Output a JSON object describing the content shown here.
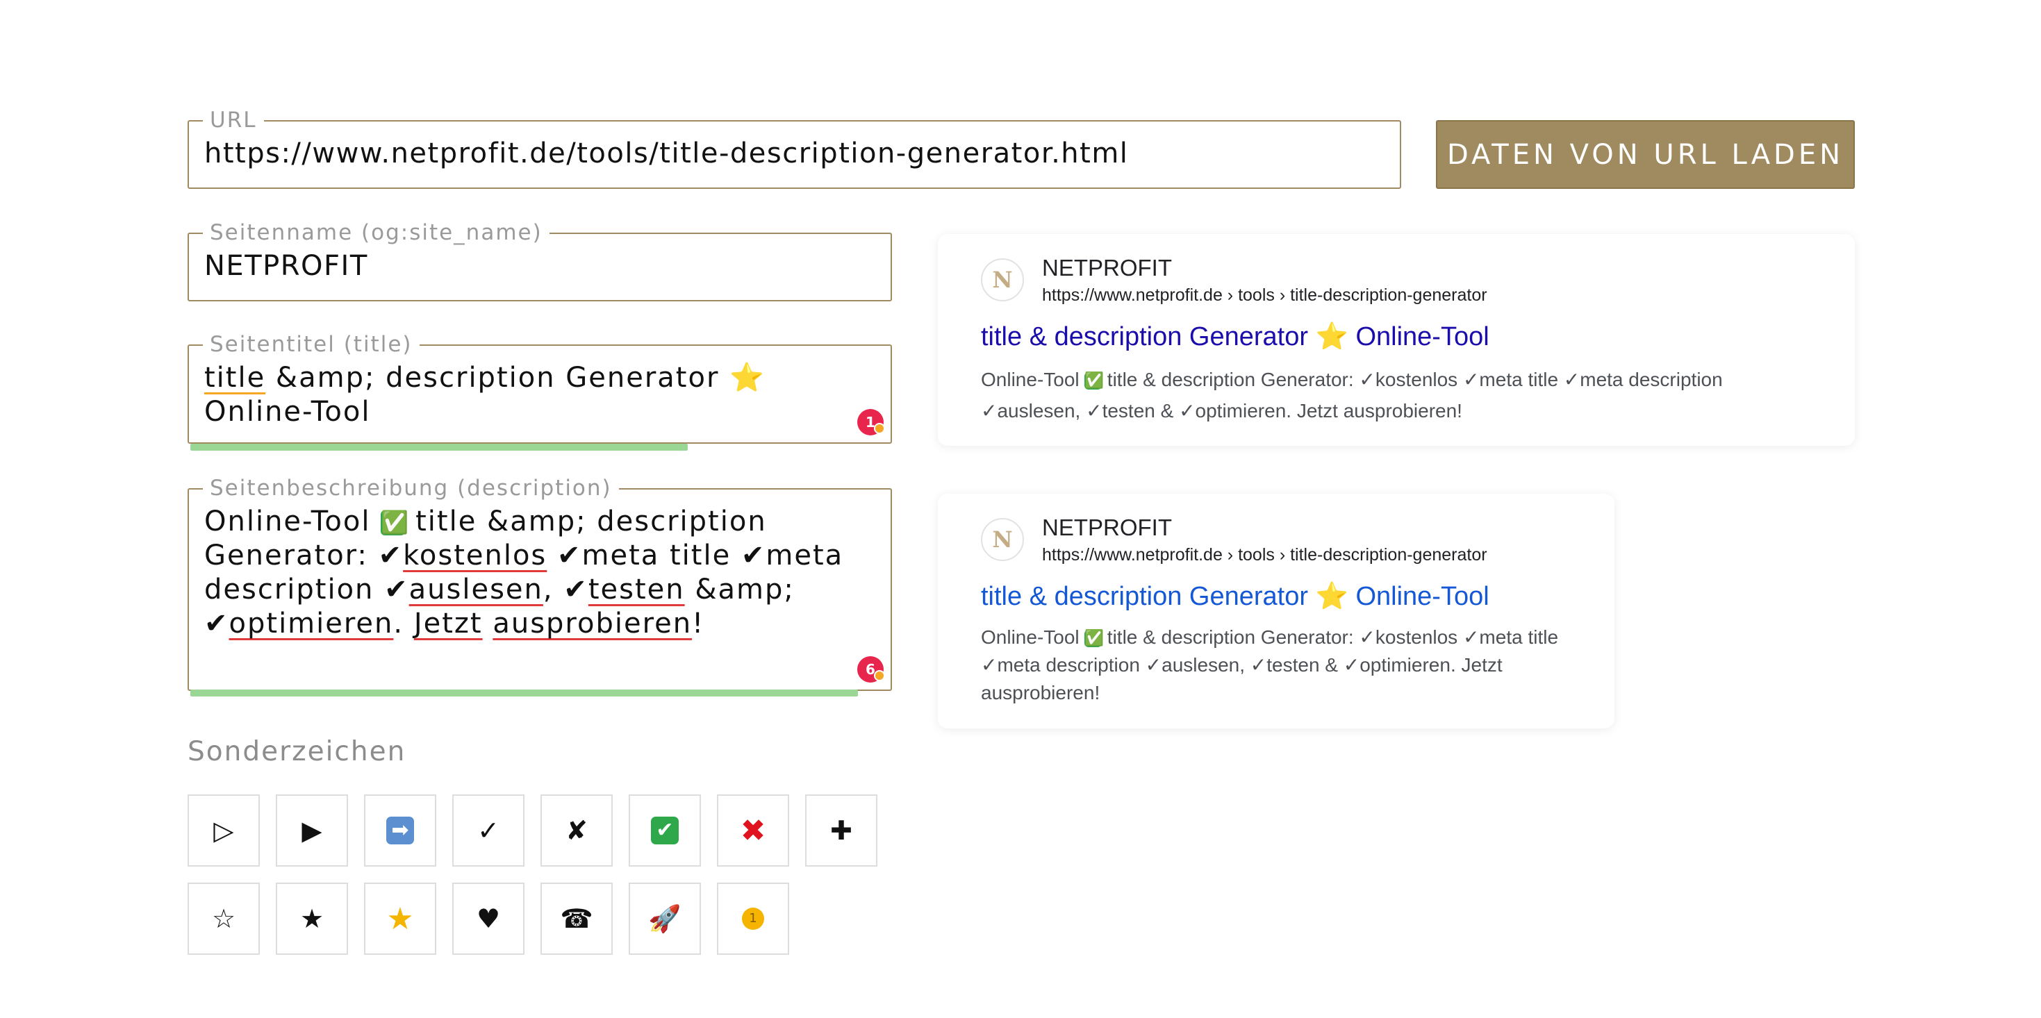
{
  "url_field": {
    "label": "URL",
    "value": "https://www.netprofit.de/tools/title-description-generator.html"
  },
  "load_button": {
    "label": "DATEN VON URL LADEN"
  },
  "site_name_field": {
    "label": "Seitenname (og:site_name)",
    "value": "NETPROFIT"
  },
  "title_field": {
    "label": "Seitentitel (title)",
    "value_parts": {
      "w1": "title",
      "t1": " &amp; description Generator ",
      "star": "⭐",
      "t2": " Online-Tool"
    },
    "counter": "1",
    "length_fraction": 0.712
  },
  "description_field": {
    "label": "Seitenbeschreibung (description)",
    "value_parts": {
      "t1": "Online-Tool ",
      "check": "✅",
      "t2": " title &amp; description Generator: ✔",
      "w1": "kostenlos",
      "t3": " ✔meta title ✔meta description ✔",
      "w2": "auslesen",
      "t4": ", ✔",
      "w3": "testen",
      "t5": " &amp; ✔",
      "w4": "optimieren",
      "t6": ". ",
      "w5": "Jetzt",
      "t7": " ",
      "w6": "ausprobieren",
      "t8": "!"
    },
    "counter": "6",
    "length_fraction": 0.955
  },
  "preview_desktop": {
    "favicon": "N",
    "site_name": "NETPROFIT",
    "url": "https://www.netprofit.de › tools › title-description-generator",
    "title": {
      "t1": "title & description Generator ",
      "star": "⭐",
      "t2": " Online-Tool"
    },
    "title_color": "#1a0dab",
    "description": {
      "t1": "Online-Tool ",
      "check": "✅",
      "t2": " title & description Generator: ✓kostenlos ✓meta title ✓meta description ✓auslesen, ✓testen & ✓optimieren. Jetzt ausprobieren!"
    }
  },
  "preview_mobile": {
    "favicon": "N",
    "site_name": "NETPROFIT",
    "url": "https://www.netprofit.de › tools › title-description-generator",
    "title": {
      "t1": "title & description Generator ",
      "star": "⭐",
      "t2": " Online-Tool"
    },
    "title_color": "#1558d6",
    "description": {
      "t1": "Online-Tool ",
      "check": "✅",
      "t2": " title & description Generator: ✓kostenlos ✓meta title ✓meta description ✓auslesen, ✓testen & ✓optimieren. Jetzt ausprobieren!"
    }
  },
  "special_chars": {
    "title": "Sonderzeichen",
    "row1": [
      {
        "glyph": "▷",
        "icon": "white-triangle-icon"
      },
      {
        "glyph": "▶",
        "icon": "black-triangle-icon"
      },
      {
        "glyph": "➡",
        "icon": "right-arrow-emoji-icon"
      },
      {
        "glyph": "✓",
        "icon": "check-mark-icon"
      },
      {
        "glyph": "✘",
        "icon": "ballot-x-icon"
      },
      {
        "glyph": "✔",
        "icon": "green-check-emoji-icon"
      },
      {
        "glyph": "✖",
        "icon": "red-cross-emoji-icon"
      },
      {
        "glyph": "✚",
        "icon": "heavy-plus-icon"
      }
    ],
    "row2": [
      {
        "glyph": "☆",
        "icon": "white-star-icon"
      },
      {
        "glyph": "★",
        "icon": "black-star-icon"
      },
      {
        "glyph": "★",
        "icon": "gold-star-emoji-icon"
      },
      {
        "glyph": "♥",
        "icon": "heart-icon"
      },
      {
        "glyph": "☎",
        "icon": "telephone-icon"
      },
      {
        "glyph": "🚀",
        "icon": "rocket-emoji-icon"
      },
      {
        "glyph": "1",
        "icon": "gold-medal-emoji-icon"
      }
    ]
  },
  "colors": {
    "accent": "#a08a5f",
    "length_bar": "#9bd794",
    "counter_badge": "#e8254d"
  }
}
